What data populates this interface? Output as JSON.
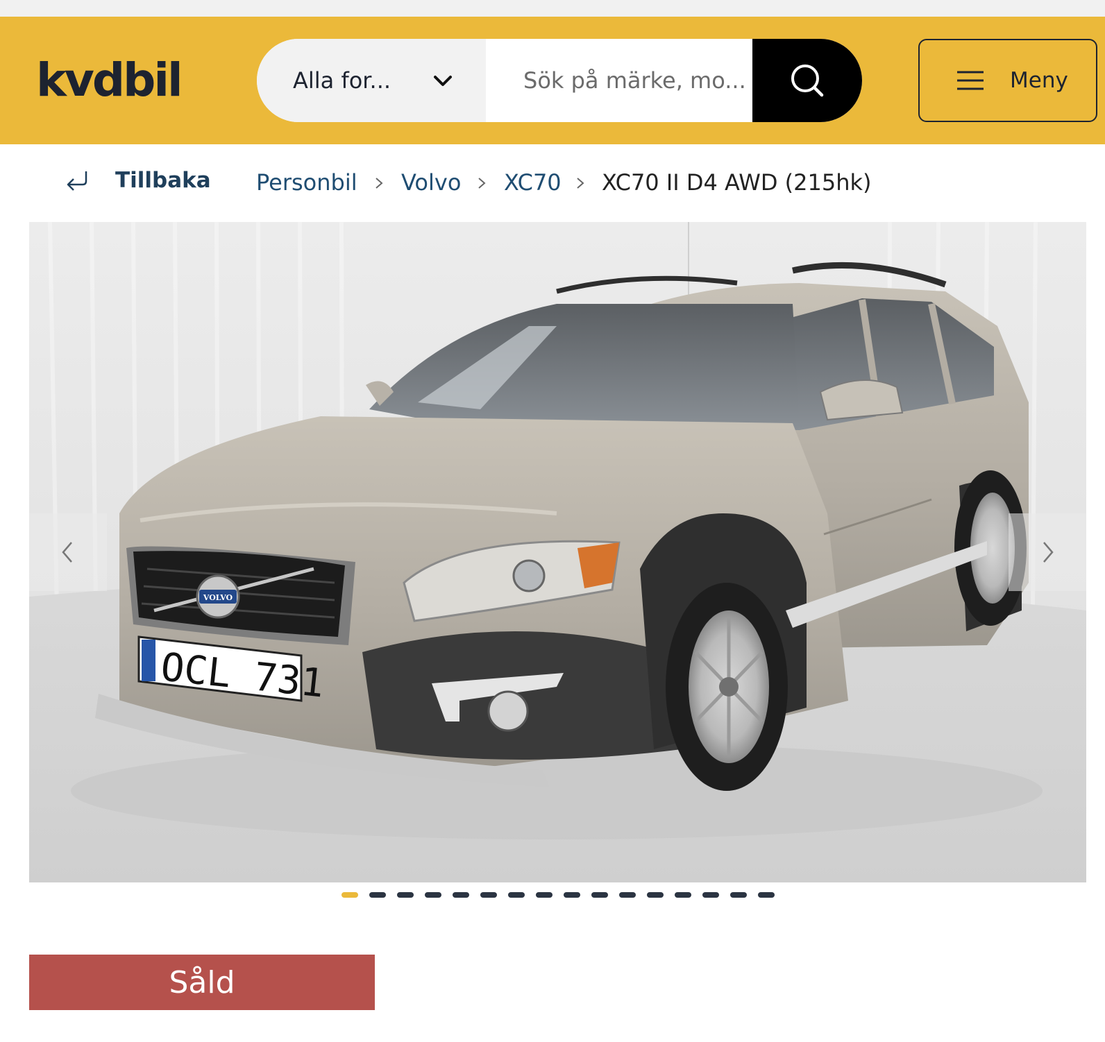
{
  "header": {
    "logo": "kvdbil",
    "category_select": {
      "label": "Alla for..."
    },
    "search": {
      "placeholder": "Sök på märke, mo..."
    },
    "menu_label": "Meny"
  },
  "breadcrumb": {
    "back_label": "Tillbaka",
    "items": [
      "Personbil",
      "Volvo",
      "XC70"
    ],
    "current": "XC70 II D4 AWD (215hk)"
  },
  "gallery": {
    "image_alt": "Volvo XC70",
    "license_plate": "OCL 731",
    "badge": "VOLVO",
    "dots_total": 16,
    "active_index": 0
  },
  "status": {
    "label": "Såld"
  },
  "colors": {
    "brand_yellow": "#ebb93a",
    "sold_red": "#b5514c",
    "link_blue": "#1f4d72"
  },
  "icons": [
    "chevron-down-icon",
    "search-icon",
    "hamburger-icon",
    "return-arrow-icon",
    "chevron-right-icon",
    "chevron-left-icon"
  ]
}
